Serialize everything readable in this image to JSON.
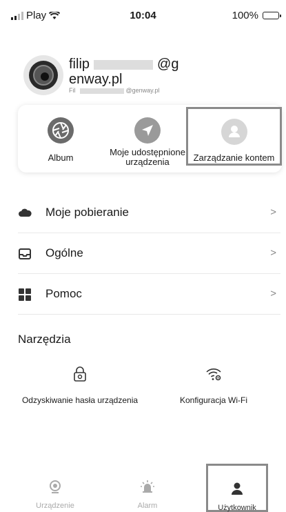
{
  "status_bar": {
    "carrier": "Play",
    "time": "10:04",
    "battery": "100%"
  },
  "profile": {
    "email_line1_start": "filip",
    "email_line1_end": "@g",
    "email_line2": "enway.pl",
    "sub_start": "Fil",
    "sub_end": "@genway.pl"
  },
  "quick_actions": [
    {
      "label": "Album"
    },
    {
      "label": "Moje udostępnione urządzenia"
    },
    {
      "label": "Zarządzanie kontem"
    }
  ],
  "menu": [
    {
      "label": "Moje pobieranie",
      "chevron": ">"
    },
    {
      "label": "Ogólne",
      "chevron": ">"
    },
    {
      "label": "Pomoc",
      "chevron": ">"
    }
  ],
  "tools_section": {
    "title": "Narzędzia",
    "items": [
      {
        "label": "Odzyskiwanie hasła urządzenia"
      },
      {
        "label": "Konfiguracja Wi-Fi"
      }
    ]
  },
  "tab_bar": [
    {
      "label": "Urządzenie",
      "active": false
    },
    {
      "label": "Alarm",
      "active": false
    },
    {
      "label": "Użytkownik",
      "active": true
    }
  ],
  "colors": {
    "accent_gray": "#8a8a8a",
    "muted_text": "#aaaaaa",
    "background": "#ffffff"
  }
}
